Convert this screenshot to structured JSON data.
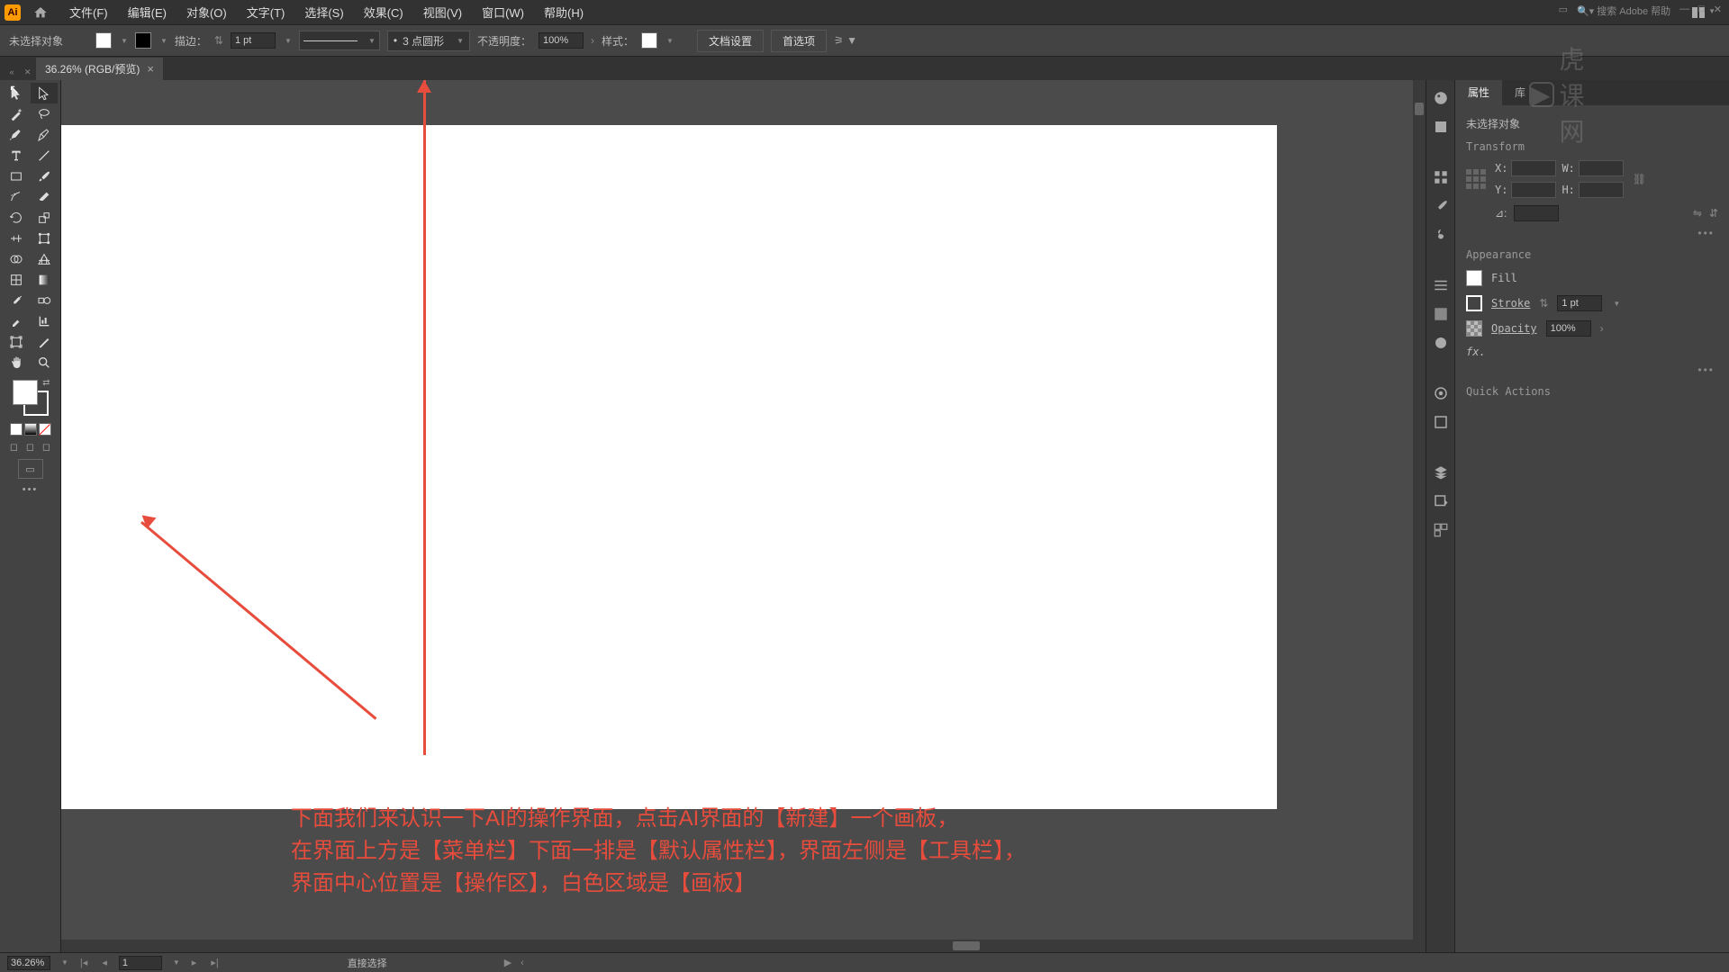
{
  "menubar": {
    "items": [
      "文件(F)",
      "编辑(E)",
      "对象(O)",
      "文字(T)",
      "选择(S)",
      "效果(C)",
      "视图(V)",
      "窗口(W)",
      "帮助(H)"
    ],
    "search_label": "搜索 Adobe 帮助"
  },
  "watermark": "虎课网",
  "control_bar": {
    "no_selection": "未选择对象",
    "stroke_label": "描边：",
    "stroke_value": "1 pt",
    "brush_value": "3 点圆形",
    "opacity_label": "不透明度：",
    "opacity_value": "100%",
    "style_label": "样式：",
    "doc_setup": "文档设置",
    "prefs": "首选项"
  },
  "doc_tab": {
    "title": "36.26% (RGB/预览)"
  },
  "annotation": "下面我们来认识一下AI的操作界面，点击AI界面的【新建】一个画板，\n在界面上方是【菜单栏】下面一排是【默认属性栏】，界面左侧是【工具栏】，\n界面中心位置是【操作区】，白色区域是【画板】",
  "panels": {
    "tab_properties": "属性",
    "tab_library": "库",
    "no_selection": "未选择对象",
    "transform_title": "Transform",
    "x_label": "X:",
    "y_label": "Y:",
    "w_label": "W:",
    "h_label": "H:",
    "angle_label": "⊿:",
    "appearance_title": "Appearance",
    "fill_label": "Fill",
    "stroke_label": "Stroke",
    "stroke_val": "1 pt",
    "opacity_label": "Opacity",
    "opacity_val": "100%",
    "fx_label": "fx.",
    "quick_actions": "Quick Actions"
  },
  "status_bar": {
    "zoom": "36.26%",
    "artboard_num": "1",
    "tool_hint": "直接选择"
  }
}
